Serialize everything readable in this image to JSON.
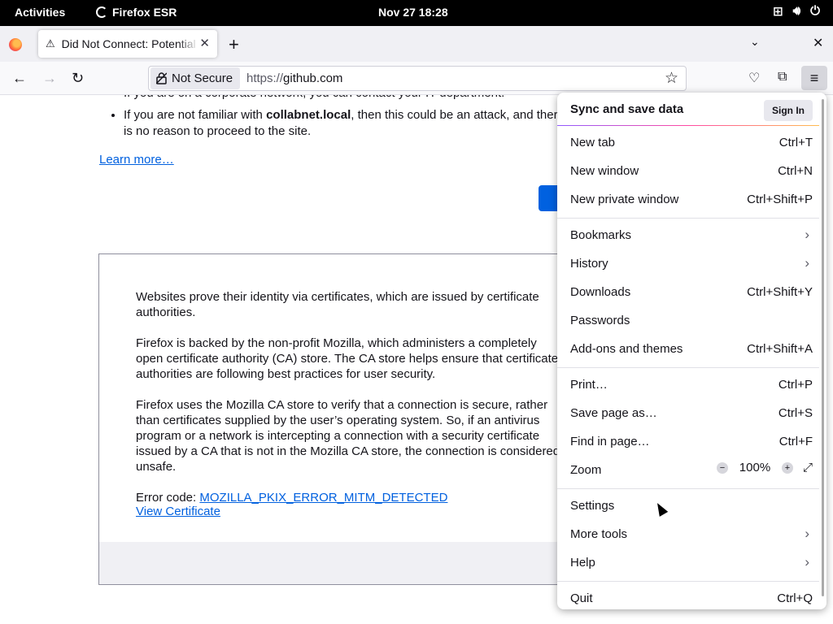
{
  "system_bar": {
    "activities": "Activities",
    "app_name": "Firefox ESR",
    "clock": "Nov 27  18:28"
  },
  "tab": {
    "title": "Did Not Connect: Potential Security Issue",
    "close": "✕"
  },
  "navbar": {
    "security_label": "Not Secure",
    "url_prefix": "https://",
    "url_host": "github.com"
  },
  "page": {
    "bullet_1": "If you are on a corporate network, you can contact your IT department.",
    "bullet_2_pre": "If you are not familiar with ",
    "bullet_2_host": "collabnet.local",
    "bullet_2_post": ", then this could be an attack, and there is no reason to proceed to the site.",
    "learn_more": "Learn more…",
    "adv_p1": "Websites prove their identity via certificates, which are issued by certificate authorities.",
    "adv_p2": "Firefox is backed by the non-profit Mozilla, which administers a completely open certificate authority (CA) store. The CA store helps ensure that certificate authorities are following best practices for user security.",
    "adv_p3": "Firefox uses the Mozilla CA store to verify that a connection is secure, rather than certificates supplied by the user’s operating system. So, if an antivirus program or a network is intercepting a connection with a security certificate issued by a CA that is not in the Mozilla CA store, the connection is considered unsafe.",
    "error_code_label": "Error code: ",
    "error_code": "MOZILLA_PKIX_ERROR_MITM_DETECTED",
    "view_certificate": "View Certificate"
  },
  "menu": {
    "sync_title": "Sync and save data",
    "sign_in": "Sign In",
    "new_tab": "New tab",
    "new_tab_sc": "Ctrl+T",
    "new_window": "New window",
    "new_window_sc": "Ctrl+N",
    "new_private_window": "New private window",
    "new_private_window_sc": "Ctrl+Shift+P",
    "bookmarks": "Bookmarks",
    "history": "History",
    "downloads": "Downloads",
    "downloads_sc": "Ctrl+Shift+Y",
    "passwords": "Passwords",
    "addons": "Add-ons and themes",
    "addons_sc": "Ctrl+Shift+A",
    "print": "Print…",
    "print_sc": "Ctrl+P",
    "save_page": "Save page as…",
    "save_page_sc": "Ctrl+S",
    "find": "Find in page…",
    "find_sc": "Ctrl+F",
    "zoom": "Zoom",
    "zoom_value": "100%",
    "settings": "Settings",
    "more_tools": "More tools",
    "help": "Help",
    "quit": "Quit",
    "quit_sc": "Ctrl+Q"
  }
}
